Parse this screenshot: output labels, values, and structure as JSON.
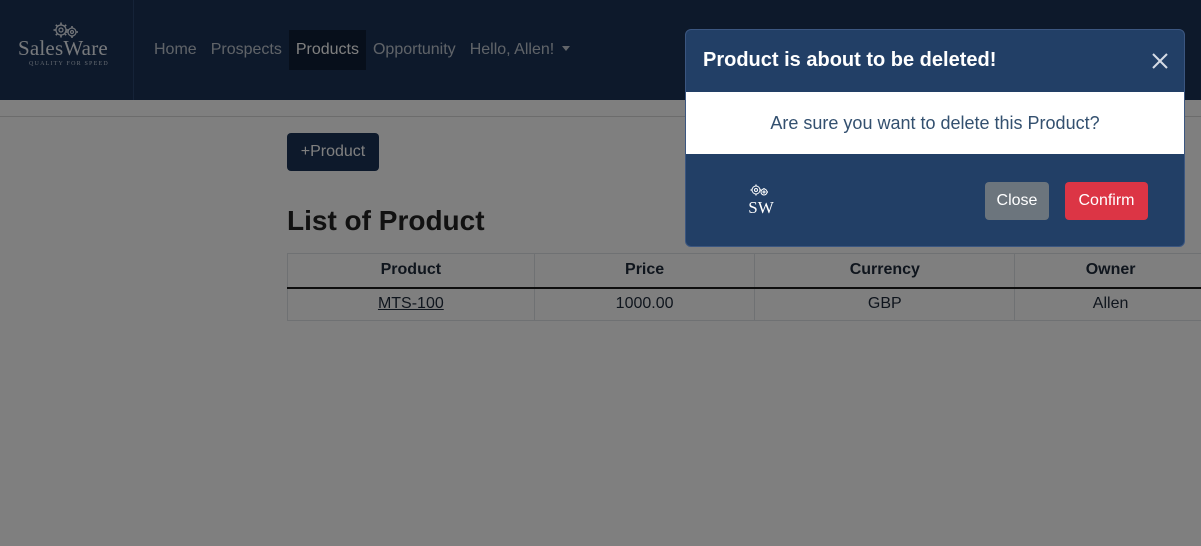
{
  "brand": {
    "name": "SalesWare",
    "tagline": "QUALITY FOR SPEED",
    "logo_icon": "gears-icon"
  },
  "nav": {
    "items": [
      {
        "label": "Home",
        "active": false
      },
      {
        "label": "Prospects",
        "active": false
      },
      {
        "label": "Products",
        "active": true
      },
      {
        "label": "Opportunity",
        "active": false
      }
    ],
    "user_menu": "Hello, Allen!"
  },
  "page": {
    "add_button": "+Product",
    "title": "List of Product",
    "table": {
      "headers": [
        "Product",
        "Price",
        "Currency",
        "Owner"
      ],
      "rows": [
        {
          "product": "MTS-100",
          "price": "1000.00",
          "currency": "GBP",
          "owner": "Allen"
        }
      ]
    }
  },
  "modal": {
    "title": "Product is about to be deleted!",
    "message": "Are sure you want to delete this Product?",
    "logo_text": "SW",
    "close_button": "Close",
    "confirm_button": "Confirm"
  },
  "colors": {
    "navbar": "#1a3356",
    "modal": "#223f66",
    "danger": "#dc3545",
    "secondary": "#6c757d"
  }
}
